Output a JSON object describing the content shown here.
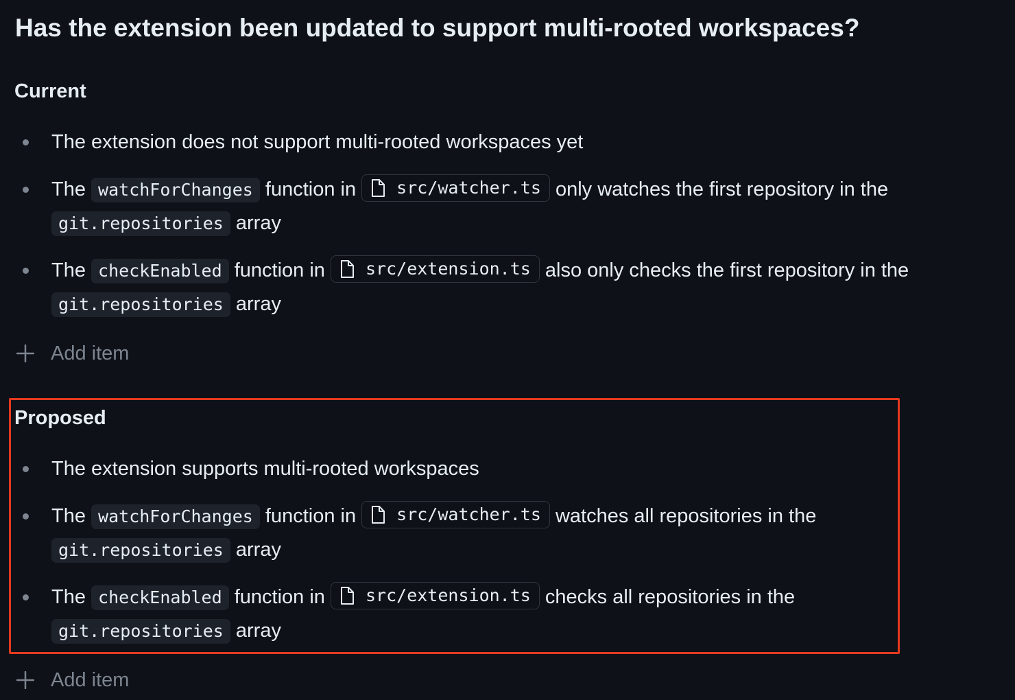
{
  "page": {
    "title": "Has the extension been updated to support multi-rooted workspaces?"
  },
  "current": {
    "heading": "Current",
    "items": [
      {
        "text": "The extension does not support multi-rooted workspaces yet"
      },
      {
        "prefix": "The",
        "code": "watchForChanges",
        "middle": "function in",
        "file": "src/watcher.ts",
        "suffix": "only watches the first repository in the",
        "code2": "git.repositories",
        "end": "array"
      },
      {
        "prefix": "The",
        "code": "checkEnabled",
        "middle": "function in",
        "file": "src/extension.ts",
        "suffix": "also only checks the first repository in the",
        "code2": "git.repositories",
        "end": "array"
      }
    ],
    "add_item_label": "Add item"
  },
  "proposed": {
    "heading": "Proposed",
    "items": [
      {
        "text": "The extension supports multi-rooted workspaces"
      },
      {
        "prefix": "The",
        "code": "watchForChanges",
        "middle": "function in",
        "file": "src/watcher.ts",
        "suffix": "watches all repositories in the",
        "code2": "git.repositories",
        "end": "array"
      },
      {
        "prefix": "The",
        "code": "checkEnabled",
        "middle": "function in",
        "file": "src/extension.ts",
        "suffix": "checks all repositories in the",
        "code2": "git.repositories",
        "end": "array"
      }
    ],
    "add_item_label": "Add item"
  },
  "icons": {
    "file": "file-icon",
    "plus": "plus-icon",
    "bullet": "bullet-dot"
  },
  "colors": {
    "background": "#0e1117",
    "text": "#e6edf3",
    "muted": "#7d8590",
    "code_bg": "#1e232b",
    "chip_border": "#30363d",
    "highlight": "#e5391f"
  }
}
